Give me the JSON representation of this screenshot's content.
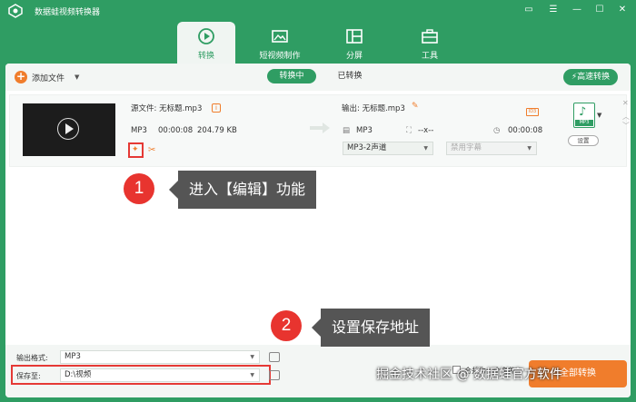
{
  "app": {
    "title": "数据蛙视频转换器",
    "accent": "#2f9d63",
    "orange": "#f07d2c",
    "red": "#e53935"
  },
  "window_controls": [
    "feedback-icon",
    "menu-icon",
    "minimize-icon",
    "maximize-icon",
    "close-icon"
  ],
  "nav": {
    "tabs": [
      {
        "label": "转换",
        "icon": "convert-icon",
        "active": true
      },
      {
        "label": "短视频制作",
        "icon": "short-video-icon",
        "active": false
      },
      {
        "label": "分屏",
        "icon": "split-screen-icon",
        "active": false
      },
      {
        "label": "工具",
        "icon": "toolbox-icon",
        "active": false
      }
    ]
  },
  "toolbar": {
    "add_file": "添加文件",
    "converting": "转换中",
    "converted": "已转换",
    "fast_convert": "高速转换"
  },
  "file": {
    "source_label": "源文件: 无标题.mp3",
    "format": "MP3",
    "duration": "00:00:08",
    "size": "204.79 KB",
    "output_label": "输出: 无标题.mp3",
    "out_format": "MP3",
    "out_resolution": "--x--",
    "out_duration": "00:00:08",
    "audio_track": "MP3-2声道",
    "subtitle": "禁用字幕",
    "format_badge": "MP3",
    "settings": "设置"
  },
  "callouts": [
    {
      "number": "1",
      "text": "进入【编辑】功能"
    },
    {
      "number": "2",
      "text": "设置保存地址"
    }
  ],
  "bottom": {
    "output_format_label": "输出格式:",
    "output_format_value": "MP3",
    "save_to_label": "保存至:",
    "save_to_value": "D:\\视频",
    "merge_label": "合并为一个文件",
    "convert_all": "全部转换"
  },
  "watermark": "掘金技术社区 @ 数据蛙官方软件"
}
